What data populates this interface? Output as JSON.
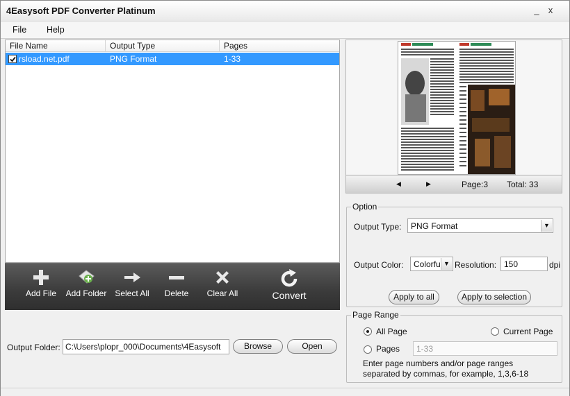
{
  "window": {
    "title": "4Easysoft PDF Converter Platinum",
    "minimize": "_",
    "close": "x"
  },
  "menu": {
    "file": "File",
    "help": "Help"
  },
  "filelist": {
    "columns": [
      "File Name",
      "Output Type",
      "Pages"
    ],
    "rows": [
      {
        "name": "rsload.net.pdf",
        "type": "PNG Format",
        "pages": "1-33",
        "checked": true
      }
    ]
  },
  "toolbar": {
    "add_file": "Add File",
    "add_folder": "Add Folder",
    "select_all": "Select All",
    "delete": "Delete",
    "clear_all": "Clear All",
    "convert": "Convert"
  },
  "output": {
    "label": "Output Folder:",
    "path": "C:\\Users\\plopr_000\\Documents\\4Easysoft",
    "browse": "Browse",
    "open": "Open"
  },
  "preview": {
    "prev": "◀",
    "next": "▶",
    "page": "Page:3",
    "total": "Total: 33"
  },
  "option": {
    "title": "Option",
    "output_type_label": "Output Type:",
    "output_type_value": "PNG Format",
    "output_color_label": "Output Color:",
    "output_color_value": "Colorfu",
    "resolution_label": "Resolution:",
    "resolution_value": "150",
    "dpi": "dpi",
    "apply_all": "Apply to all",
    "apply_selection": "Apply to selection"
  },
  "range": {
    "title": "Page Range",
    "all_page": "All Page",
    "current_page": "Current Page",
    "pages": "Pages",
    "pages_value": "1-33",
    "hint1": "Enter page numbers and/or page ranges",
    "hint2": "separated by commas, for example, 1,3,6-18",
    "selected": "all_page"
  },
  "colors": {
    "selection": "#3399ff",
    "toolbar": "#3b3b3b"
  }
}
